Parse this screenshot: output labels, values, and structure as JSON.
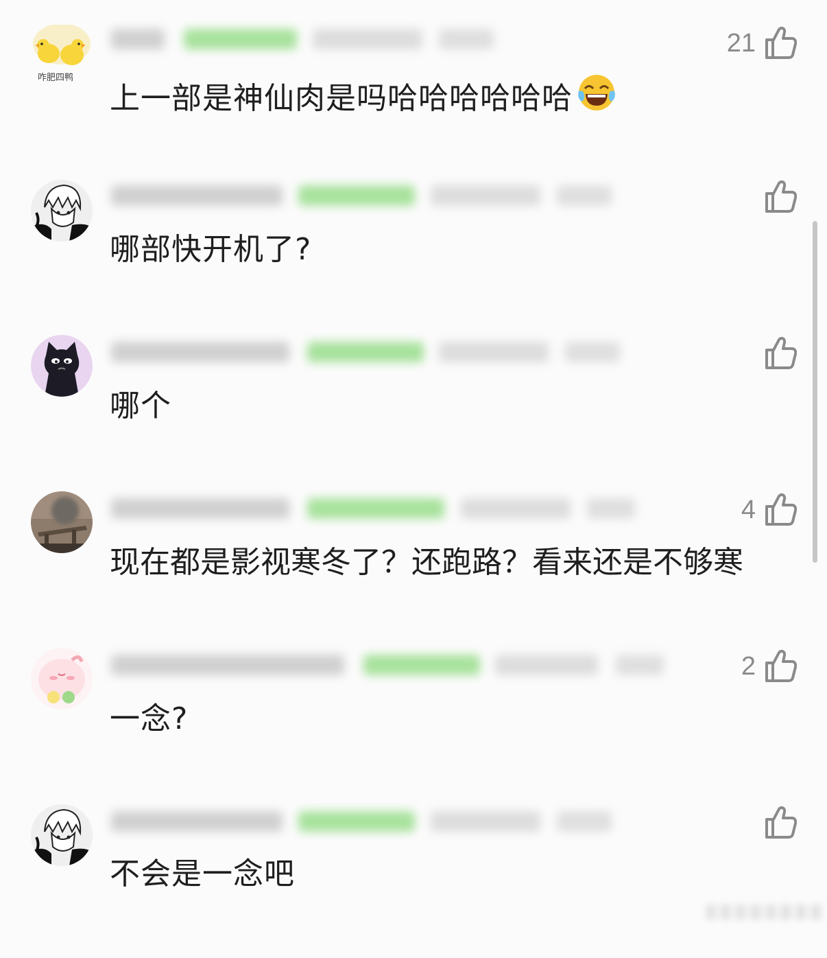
{
  "colors": {
    "background": "#fbfbfb",
    "text": "#1e1e1e",
    "like_icon": "#8a8a8a",
    "tag_green": "#7bd46a"
  },
  "comments": [
    {
      "avatar_caption": "咋肥四鸭",
      "avatar_icon": "yellow-ducks-avatar",
      "like_count": "21",
      "text": "上一部是神仙肉是吗哈哈哈哈哈哈",
      "emoji": "laughing-tears-emoji"
    },
    {
      "avatar_icon": "anime-boy-avatar",
      "like_count": "",
      "text": "哪部快开机了?"
    },
    {
      "avatar_icon": "black-cat-avatar",
      "like_count": "",
      "text": "哪个"
    },
    {
      "avatar_icon": "photo-avatar",
      "like_count": "4",
      "text": "现在都是影视寒冬了？还跑路？看来还是不够寒"
    },
    {
      "avatar_icon": "pink-character-avatar",
      "like_count": "2",
      "text": "一念?"
    },
    {
      "avatar_icon": "anime-boy-avatar",
      "like_count": "",
      "text": "不会是一念吧"
    }
  ]
}
